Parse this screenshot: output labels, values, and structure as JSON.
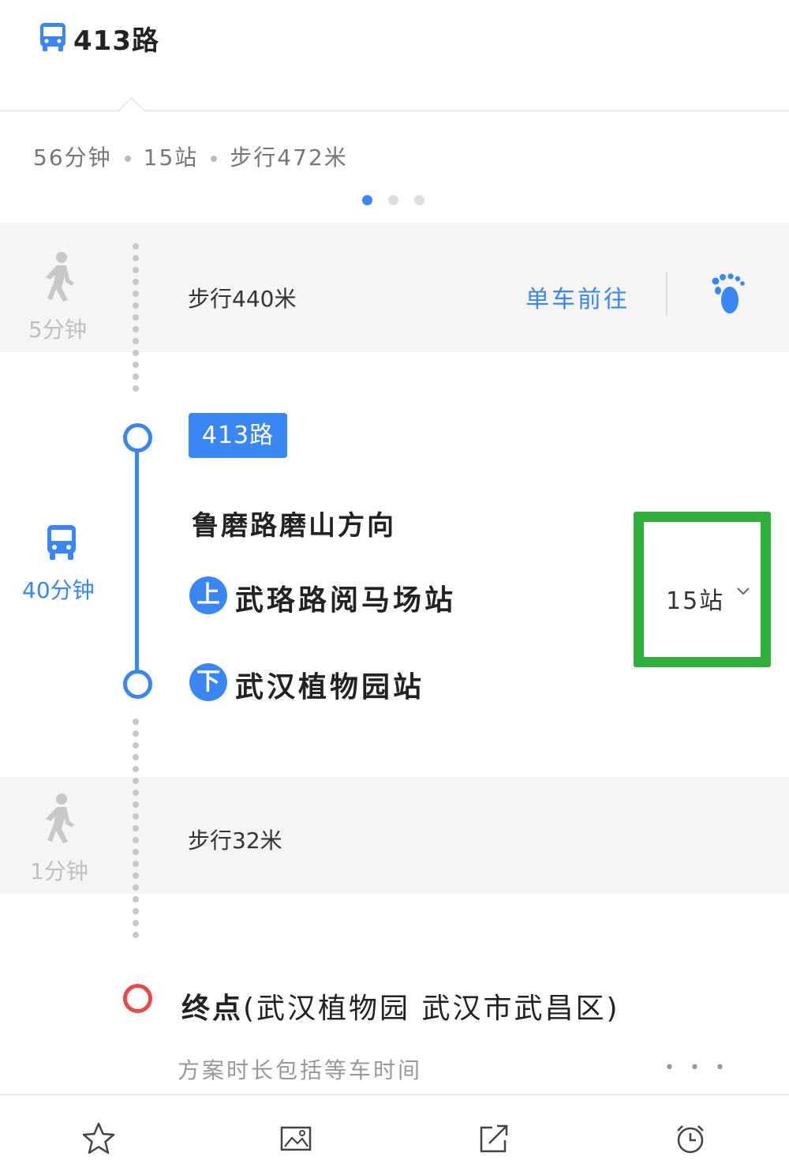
{
  "header": {
    "route_name": "413路"
  },
  "summary": {
    "duration": "56分钟",
    "stops": "15站",
    "walk": "步行472米",
    "pages": 3,
    "active_page": 1
  },
  "walk1": {
    "time": "5分钟",
    "distance": "步行440米",
    "bike_link": "单车前往"
  },
  "bus": {
    "tag": "413路",
    "time": "40分钟",
    "direction": "鲁磨路磨山方向",
    "board_badge": "上",
    "board_stop": "武珞路阅马场站",
    "alight_badge": "下",
    "alight_stop": "武汉植物园站",
    "stop_count": "15站"
  },
  "walk2": {
    "time": "1分钟",
    "distance": "步行32米"
  },
  "destination": {
    "prefix": "终点",
    "detail": "(武汉植物园  武汉市武昌区)",
    "note": "方案时长包括等车时间"
  },
  "colors": {
    "accent": "#3a86f3",
    "highlight_box": "#2eb03a",
    "destination_ring": "#e84a4a"
  },
  "icons": [
    "bus-icon",
    "walk-icon",
    "footprint-icon",
    "chevron-down-icon",
    "star-icon",
    "image-icon",
    "share-icon",
    "alarm-icon"
  ]
}
